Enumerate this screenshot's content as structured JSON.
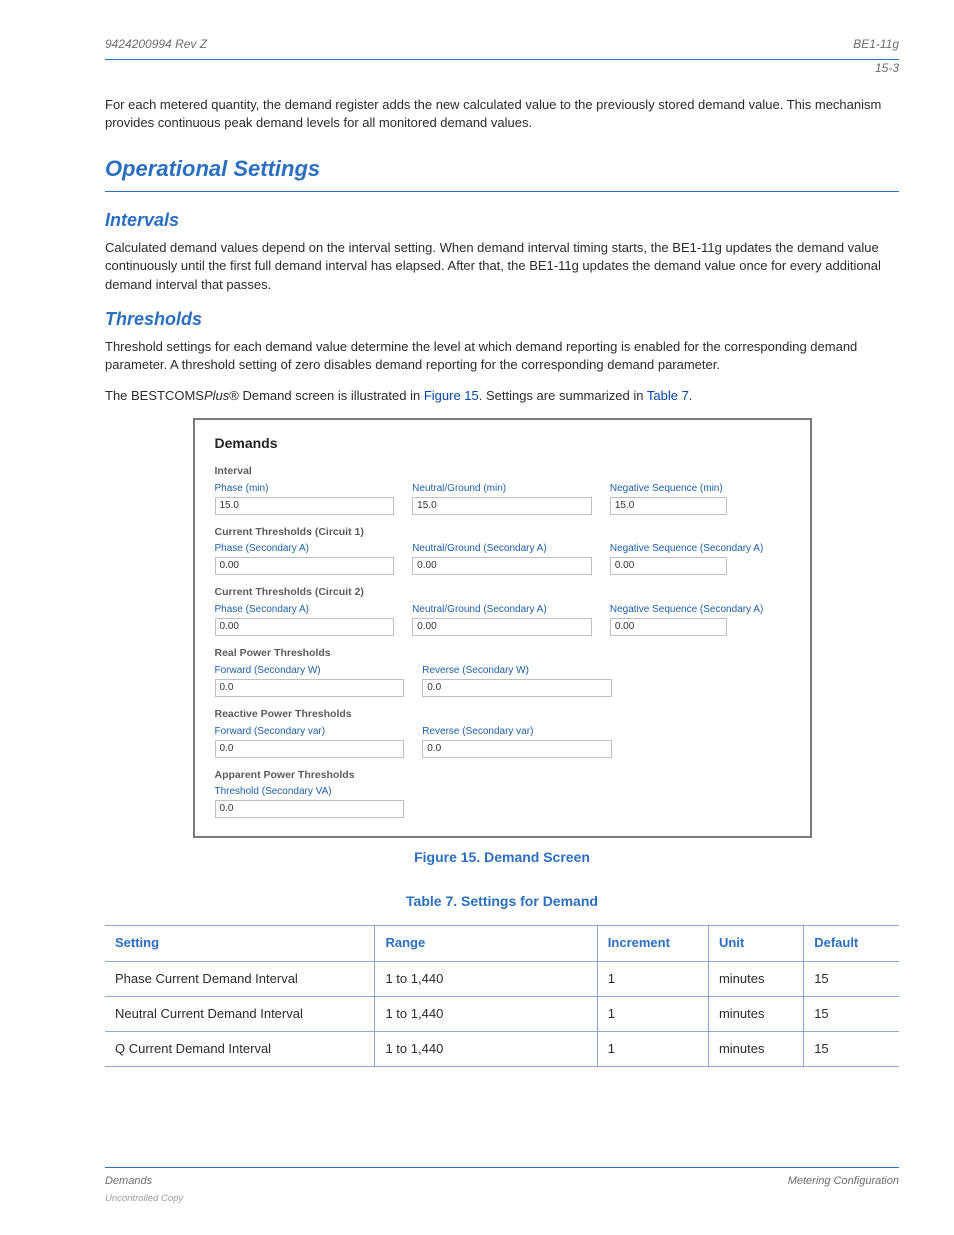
{
  "header": {
    "left": "9424200994 Rev Z",
    "right": "BE1-11g"
  },
  "footer": {
    "left": "Demands",
    "right": "Metering Configuration",
    "sub": "Uncontrolled Copy"
  },
  "intro_para": "For each metered quantity, the demand register adds the new calculated value to the previously stored demand value. This mechanism provides continuous peak demand levels for all monitored demand values.",
  "section_title": "Operational Settings",
  "intervals": {
    "title": "Intervals",
    "para": "Calculated demand values depend on the interval setting. When demand interval timing starts, the BE1-11g updates the demand value continuously until the first full demand interval has elapsed. After that, the BE1-11g updates the demand value once for every additional demand interval that passes."
  },
  "thresholds": {
    "title": "Thresholds",
    "para": "Threshold settings for each demand value determine the level at which demand reporting is enabled for the corresponding demand parameter. A threshold setting of zero disables demand reporting for the corresponding demand parameter."
  },
  "setting_demands_intro": {
    "prefix": "The BESTCOMS",
    "reg": "Plus",
    "suffix": "® Demand screen is illustrated in ",
    "link": "Figure 15",
    "rest": ". Settings are summarized in ",
    "link2": "Table 7",
    "period": "."
  },
  "fig": {
    "title": "Demands",
    "caption": "Figure 15. Demand Screen",
    "interval": {
      "group": "Interval",
      "phase_l": "Phase (min)",
      "phase_v": "15.0",
      "ng_l": "Neutral/Ground (min)",
      "ng_v": "15.0",
      "neg_l": "Negative Sequence (min)",
      "neg_v": "15.0"
    },
    "ct1": {
      "group": "Current Thresholds (Circuit 1)",
      "phase_l": "Phase (Secondary A)",
      "phase_v": "0.00",
      "ng_l": "Neutral/Ground (Secondary A)",
      "ng_v": "0.00",
      "neg_l": "Negative Sequence (Secondary A)",
      "neg_v": "0.00"
    },
    "ct2": {
      "group": "Current Thresholds (Circuit 2)",
      "phase_l": "Phase (Secondary A)",
      "phase_v": "0.00",
      "ng_l": "Neutral/Ground (Secondary A)",
      "ng_v": "0.00",
      "neg_l": "Negative Sequence (Secondary A)",
      "neg_v": "0.00"
    },
    "real": {
      "group": "Real Power Thresholds",
      "fwd_l": "Forward (Secondary W)",
      "fwd_v": "0.0",
      "rev_l": "Reverse (Secondary W)",
      "rev_v": "0.0"
    },
    "reactive": {
      "group": "Reactive Power Thresholds",
      "fwd_l": "Forward (Secondary var)",
      "fwd_v": "0.0",
      "rev_l": "Reverse (Secondary var)",
      "rev_v": "0.0"
    },
    "apparent": {
      "group": "Apparent Power Thresholds",
      "thr_l": "Threshold (Secondary VA)",
      "thr_v": "0.0"
    }
  },
  "table": {
    "caption": "Table 7. Settings for Demand",
    "headers": [
      "Setting",
      "Range",
      "Increment",
      "Unit",
      "Default"
    ],
    "rows": [
      [
        "Phase Current Demand Interval",
        "1 to 1,440",
        "1",
        "minutes",
        "15"
      ],
      [
        "Neutral Current Demand Interval",
        "1 to 1,440",
        "1",
        "minutes",
        "15"
      ],
      [
        "Q Current Demand Interval",
        "1 to 1,440",
        "1",
        "minutes",
        "15"
      ]
    ]
  },
  "page_num": "15-3"
}
